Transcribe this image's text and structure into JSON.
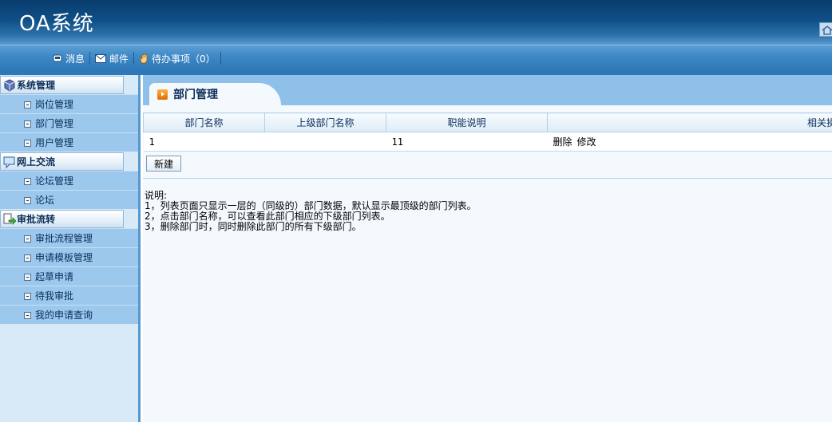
{
  "app": {
    "title": "OA系统"
  },
  "topbar": {
    "items": [
      {
        "label": "消息",
        "icon": "message-icon"
      },
      {
        "label": "邮件",
        "icon": "mail-icon"
      },
      {
        "label": "待办事项（0）",
        "icon": "hand-icon"
      }
    ]
  },
  "sidebar": {
    "groups": [
      {
        "label": "系统管理",
        "icon": "system-icon",
        "items": [
          {
            "label": "岗位管理"
          },
          {
            "label": "部门管理"
          },
          {
            "label": "用户管理"
          }
        ]
      },
      {
        "label": "网上交流",
        "icon": "chat-icon",
        "items": [
          {
            "label": "论坛管理"
          },
          {
            "label": "论坛"
          }
        ]
      },
      {
        "label": "审批流转",
        "icon": "flow-icon",
        "items": [
          {
            "label": "审批流程管理"
          },
          {
            "label": "申请模板管理"
          },
          {
            "label": "起草申请"
          },
          {
            "label": "待我审批"
          },
          {
            "label": "我的申请查询"
          }
        ]
      }
    ]
  },
  "main": {
    "title": "部门管理",
    "table": {
      "headers": [
        "部门名称",
        "上级部门名称",
        "职能说明",
        "相关操作"
      ],
      "rows": [
        {
          "name": "1",
          "parent": "",
          "desc": "11",
          "ops": [
            "删除",
            "修改"
          ]
        }
      ]
    },
    "new_button": "新建",
    "notes": [
      "说明:",
      "1，列表页面只显示一层的（同级的）部门数据，默认显示最顶级的部门列表。",
      "2，点击部门名称，可以查看此部门相应的下级部门列表。",
      "3，删除部门时，同时删除此部门的所有下级部门。"
    ]
  }
}
